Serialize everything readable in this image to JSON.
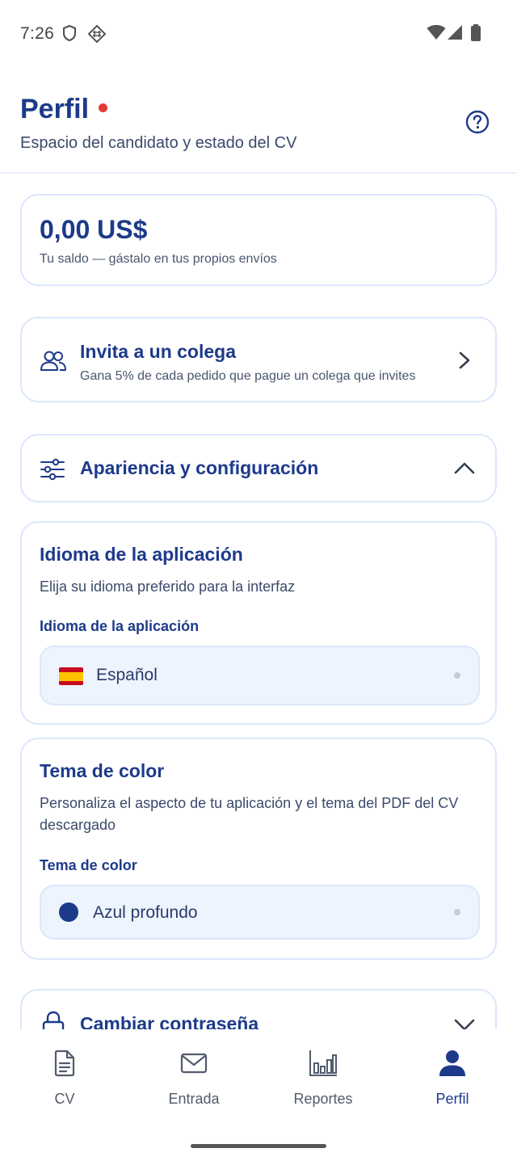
{
  "status_bar": {
    "time": "7:26",
    "icons": [
      "shield-icon",
      "hash-icon",
      "wifi-icon",
      "signal-icon",
      "battery-icon"
    ]
  },
  "header": {
    "title": "Perfil",
    "subtitle": "Espacio del candidato y estado del CV",
    "help_icon": "help-circle-icon"
  },
  "balance": {
    "amount": "0,00 US$",
    "note": "Tu saldo — gástalo en tus propios envíos"
  },
  "invite": {
    "title": "Invita a un colega",
    "subtitle": "Gana 5% de cada pedido que pague un colega que invites",
    "icon": "users-icon"
  },
  "settings": {
    "title": "Apariencia y configuración",
    "icon": "sliders-icon",
    "expanded": true
  },
  "language": {
    "title": "Idioma de la aplicación",
    "description": "Elija su idioma preferido para la interfaz",
    "field_label": "Idioma de la aplicación",
    "selected": "Español",
    "flag": "spain-flag"
  },
  "theme": {
    "title": "Tema de color",
    "description": "Personaliza el aspecto de tu aplicación y el tema del PDF del CV descargado",
    "field_label": "Tema de color",
    "selected": "Azul profundo",
    "swatch_color": "#1d3a8a"
  },
  "password": {
    "title": "Cambiar contraseña",
    "icon": "lock-icon"
  },
  "bottom_nav": [
    {
      "label": "CV",
      "icon": "document-icon",
      "active": false
    },
    {
      "label": "Entrada",
      "icon": "mail-icon",
      "active": false
    },
    {
      "label": "Reportes",
      "icon": "bar-chart-icon",
      "active": false
    },
    {
      "label": "Perfil",
      "icon": "person-icon",
      "active": true
    }
  ],
  "colors": {
    "primary": "#1d3a8a",
    "card_border": "#dbe7fb",
    "field_bg": "#edf4fd",
    "notification_dot": "#e53935"
  }
}
